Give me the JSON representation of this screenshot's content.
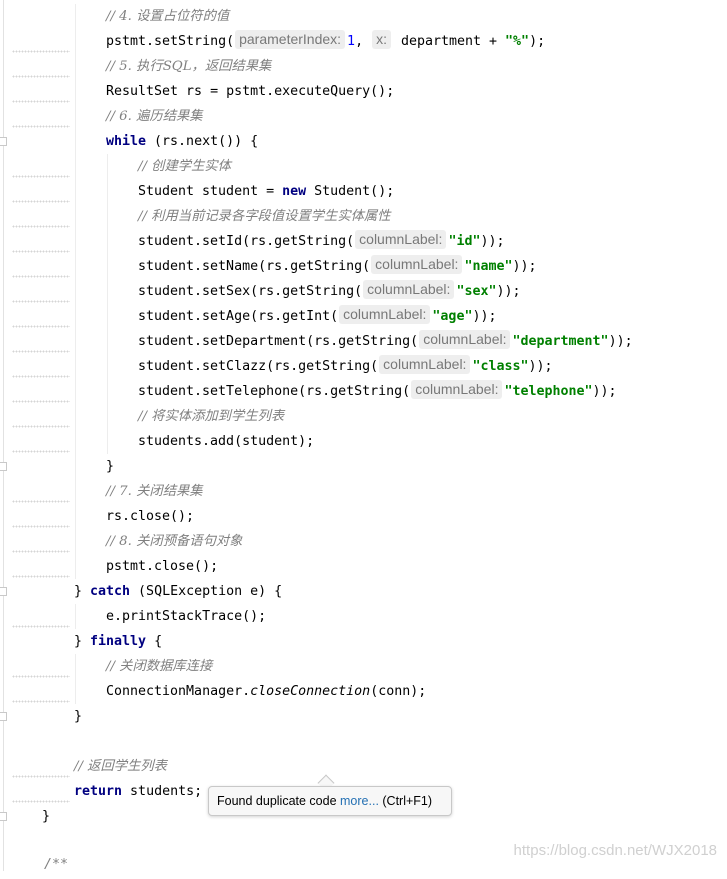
{
  "code": {
    "c4": "// 4. 设置占位符的值",
    "l_setstring_a": "pstmt.setString(",
    "h_paramindex": "parameterIndex:",
    "v_one": "1",
    "l_comma": ", ",
    "h_x": "x:",
    "l_dept_plus": " department + ",
    "s_percent": "\"%\"",
    "l_close_paren_semi": ");",
    "c5": "// 5. 执行SQL，返回结果集",
    "l_resultset": "ResultSet rs = pstmt.executeQuery();",
    "c6": "// 6. 遍历结果集",
    "kw_while": "while",
    "l_while_rest": " (rs.next()) {",
    "c_create": "// 创建学生实体",
    "l_student_a": "Student student = ",
    "kw_new": "new",
    "l_student_b": " Student();",
    "c_set_attrs": "// 利用当前记录各字段值设置学生实体属性",
    "l_setid": "student.setId(rs.getString(",
    "l_setname": "student.setName(rs.getString(",
    "l_setsex": "student.setSex(rs.getString(",
    "l_setage": "student.setAge(rs.getInt(",
    "l_setdept": "student.setDepartment(rs.getString(",
    "l_setclazz": "student.setClazz(rs.getString(",
    "l_settel": "student.setTelephone(rs.getString(",
    "h_columnlabel": "columnLabel:",
    "s_id": "\"id\"",
    "s_name": "\"name\"",
    "s_sex": "\"sex\"",
    "s_age": "\"age\"",
    "s_department": "\"department\"",
    "s_class": "\"class\"",
    "s_telephone": "\"telephone\"",
    "l_double_close": "));",
    "c_add": "// 将实体添加到学生列表",
    "l_add": "students.add(student);",
    "l_brace_close": "}",
    "c7": "// 7. 关闭结果集",
    "l_rs_close": "rs.close();",
    "c8": "// 8. 关闭预备语句对象",
    "l_pstmt_close": "pstmt.close();",
    "l_catch_a": "} ",
    "kw_catch": "catch",
    "l_catch_b": " (SQLException e) {",
    "l_print": "e.printStackTrace();",
    "l_finally_a": "} ",
    "kw_finally": "finally",
    "l_finally_b": " {",
    "c_close_conn": "// 关闭数据库连接",
    "l_connmgr_a": "ConnectionManager.",
    "l_connmgr_method": "closeConnection",
    "l_connmgr_b": "(conn);",
    "c_return": "// 返回学生列表",
    "kw_return": "return",
    "l_return_rest": " students;",
    "l_doc": "/**"
  },
  "tooltip": {
    "text": "Found duplicate code ",
    "link": "more...",
    "shortcut": " (Ctrl+F1)"
  },
  "watermark": "https://blog.csdn.net/WJX2018"
}
